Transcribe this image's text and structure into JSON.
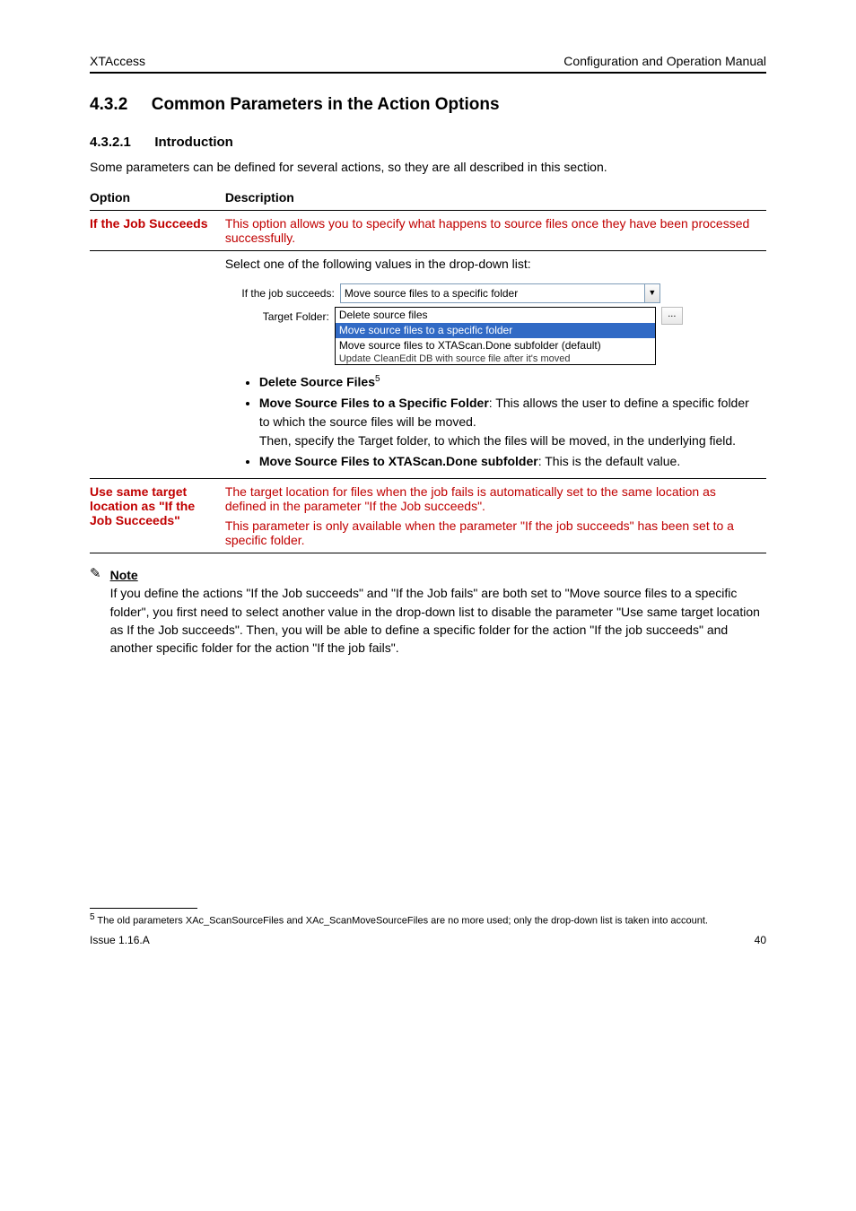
{
  "header": {
    "product": "XTAccess",
    "doc": "Configuration and Operation Manual"
  },
  "section": {
    "number": "4.3.2",
    "title": "Common Parameters in the Action Options"
  },
  "intro": {
    "heading_number": "4.3.2.1",
    "heading_title": "Introduction",
    "text": "Some parameters can be defined for several actions, so they are all described in this section."
  },
  "table_if_succeeds": {
    "option_label": "Option",
    "description_label": "Description",
    "option": "If the Job Succeeds",
    "desc1": "This option allows you to specify what happens to source files once they have been processed successfully.",
    "desc2": "Select one of the following values in the drop-down list:",
    "dropdown": {
      "label": "If the job succeeds:",
      "selected": "Move source files to a specific folder",
      "options": [
        "Delete source files",
        "Move source files to a specific folder",
        "Move source files to XTAScan.Done subfolder (default)"
      ],
      "partial_option": "Update CleanEdit DB with source file after it's moved"
    },
    "target_folder_label": "Target Folder:",
    "bullet1": "Delete Source Files",
    "bullet2": "Move Source Files to a Specific Folder",
    "bullet2_extra": ": This allows the user to define a specific folder to which the source files will be moved.",
    "bullet3": "Move Source Files to XTAScan.Done subfolder",
    "bullet3_extra": ": This is the default value.",
    "footnote_ref": "5",
    "footnote_text": "Then, specify the Target folder, to which the files will be moved, in the underlying field."
  },
  "table_same_loc": {
    "option": "Use same target location as \"If the Job Succeeds\"",
    "desc": "The target location for files when the job fails is automatically set to the same location as defined in the parameter \"If the Job succeeds\".",
    "note": "This parameter is only available when the parameter \"If the job succeeds\" has been set to a specific folder."
  },
  "note": {
    "label": "Note",
    "text": "If you define the actions \"If the Job succeeds\" and \"If the Job fails\" are both set to \"Move source files to a specific folder\", you first need to select another value in the drop-down list to disable the parameter \"Use same target location as If the Job succeeds\". Then, you will be able to define a specific folder for the action \"If the job succeeds\" and another specific folder for the action \"If the job fails\"."
  },
  "footnote": {
    "number": "5",
    "text": "The old parameters XAc_ScanSourceFiles and XAc_ScanMoveSourceFiles are no more used; only the drop-down list is taken into account."
  },
  "footer": {
    "issue": "Issue 1.16.A",
    "page": "40"
  }
}
